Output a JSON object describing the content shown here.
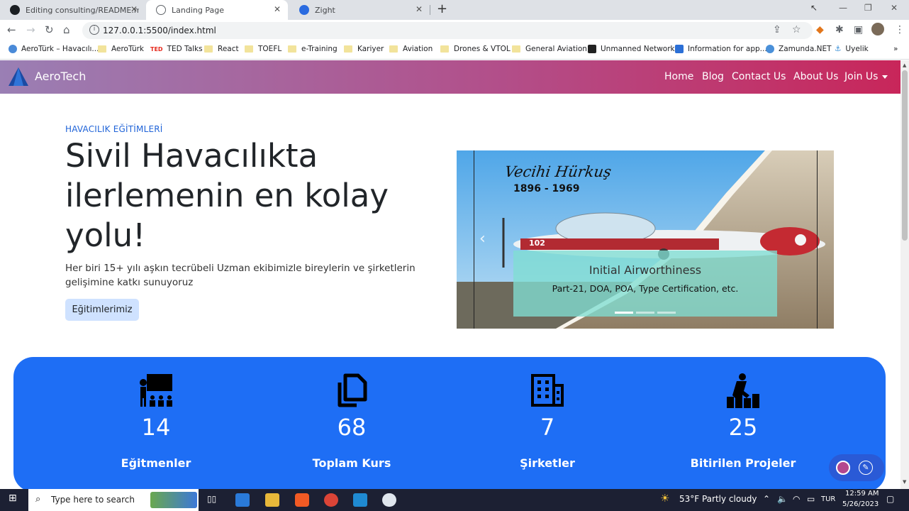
{
  "browser": {
    "tabs": [
      {
        "title": "Editing consulting/README.md a"
      },
      {
        "title": "Landing Page"
      },
      {
        "title": "Zight"
      }
    ],
    "url": "127.0.0.1:5500/index.html",
    "bookmarks": [
      "AeroTürk – Havacılı...",
      "AeroTürk",
      "TED Talks",
      "React",
      "TOEFL",
      "e-Training",
      "Kariyer",
      "Aviation",
      "Drones & VTOL",
      "General Aviation",
      "Unmanned Network",
      "Information for app...",
      "Zamunda.NET",
      "Uyelik"
    ]
  },
  "navbar": {
    "brand": "AeroTech",
    "links": [
      "Home",
      "Blog",
      "Contact Us",
      "About Us",
      "Join Us"
    ]
  },
  "hero": {
    "eyebrow": "HAVACILIK EĞİTİMLERİ",
    "headline": "Sivil Havacılıkta ilerlemenin en kolay yolu!",
    "lead": "Her biri 15+ yılı aşkın tecrübeli Uzman ekibimizle bireylerin ve şirketlerin gelişimine katkı sunuyoruz",
    "cta": "Eğitimlerimiz"
  },
  "carousel": {
    "stamp_name": "Vecihi Hürkuş",
    "stamp_years": "1896 - 1969",
    "aircraft_number": "102",
    "caption_title": "Initial Airworthiness",
    "caption_text": "Part-21, DOA, POA, Type Certification, etc.",
    "slide_count": 3,
    "active_slide": 1
  },
  "stats": [
    {
      "icon": "teacher-icon",
      "value": "14",
      "label": "Eğitmenler"
    },
    {
      "icon": "copy-icon",
      "value": "68",
      "label": "Toplam Kurs"
    },
    {
      "icon": "building-icon",
      "value": "7",
      "label": "Şirketler"
    },
    {
      "icon": "progress-icon",
      "value": "25",
      "label": "Bitirilen Projeler"
    }
  ],
  "taskbar": {
    "search_placeholder": "Type here to search",
    "weather": "53°F  Partly cloudy",
    "language": "TUR",
    "time": "12:59 AM",
    "date": "5/26/2023"
  },
  "colors": {
    "accent": "#1e6ef5",
    "eyebrow": "#1f63d8",
    "navbar_start": "#9a7fb4",
    "navbar_end": "#c8265a"
  }
}
